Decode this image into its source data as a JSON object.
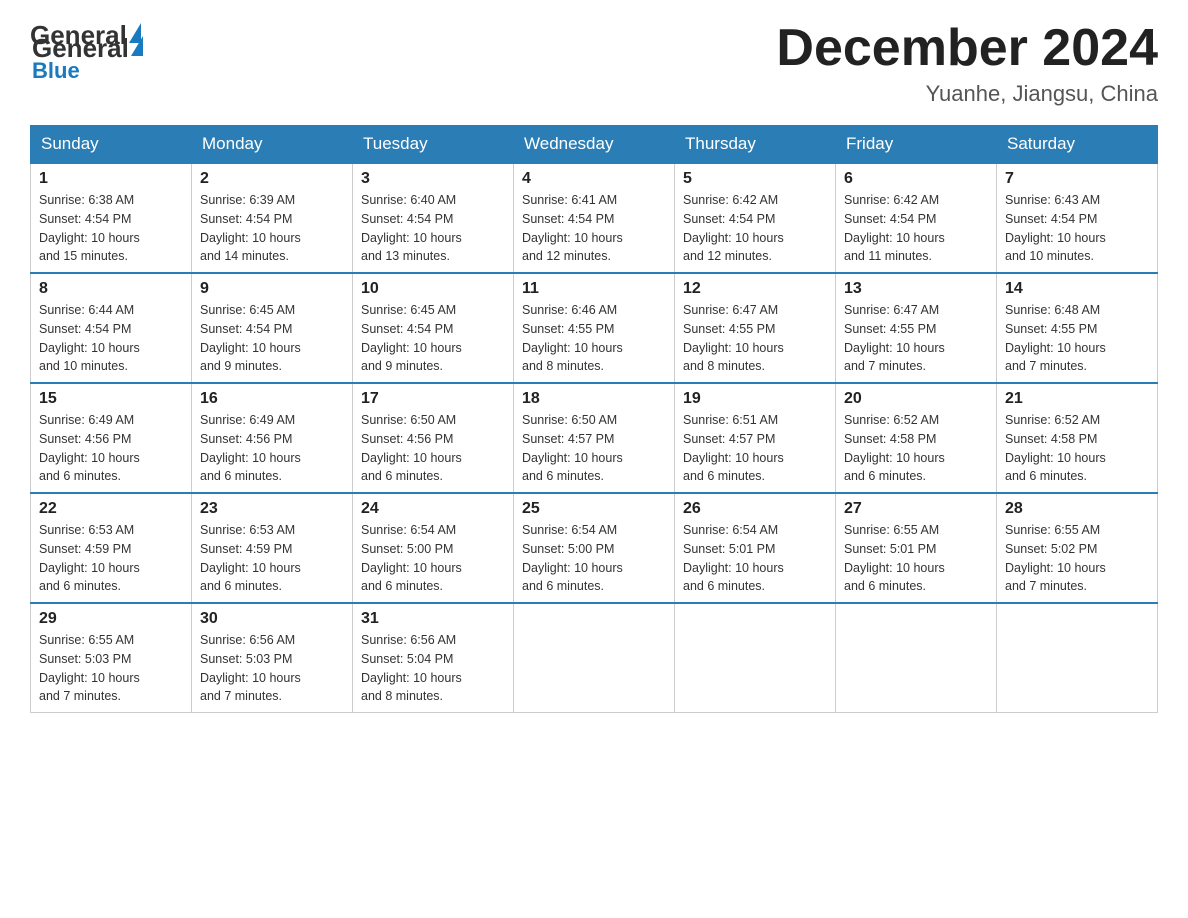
{
  "logo": {
    "general": "General",
    "blue": "Blue"
  },
  "title": "December 2024",
  "subtitle": "Yuanhe, Jiangsu, China",
  "days_of_week": [
    "Sunday",
    "Monday",
    "Tuesday",
    "Wednesday",
    "Thursday",
    "Friday",
    "Saturday"
  ],
  "weeks": [
    [
      {
        "day": "1",
        "sunrise": "6:38 AM",
        "sunset": "4:54 PM",
        "daylight": "10 hours and 15 minutes."
      },
      {
        "day": "2",
        "sunrise": "6:39 AM",
        "sunset": "4:54 PM",
        "daylight": "10 hours and 14 minutes."
      },
      {
        "day": "3",
        "sunrise": "6:40 AM",
        "sunset": "4:54 PM",
        "daylight": "10 hours and 13 minutes."
      },
      {
        "day": "4",
        "sunrise": "6:41 AM",
        "sunset": "4:54 PM",
        "daylight": "10 hours and 12 minutes."
      },
      {
        "day": "5",
        "sunrise": "6:42 AM",
        "sunset": "4:54 PM",
        "daylight": "10 hours and 12 minutes."
      },
      {
        "day": "6",
        "sunrise": "6:42 AM",
        "sunset": "4:54 PM",
        "daylight": "10 hours and 11 minutes."
      },
      {
        "day": "7",
        "sunrise": "6:43 AM",
        "sunset": "4:54 PM",
        "daylight": "10 hours and 10 minutes."
      }
    ],
    [
      {
        "day": "8",
        "sunrise": "6:44 AM",
        "sunset": "4:54 PM",
        "daylight": "10 hours and 10 minutes."
      },
      {
        "day": "9",
        "sunrise": "6:45 AM",
        "sunset": "4:54 PM",
        "daylight": "10 hours and 9 minutes."
      },
      {
        "day": "10",
        "sunrise": "6:45 AM",
        "sunset": "4:54 PM",
        "daylight": "10 hours and 9 minutes."
      },
      {
        "day": "11",
        "sunrise": "6:46 AM",
        "sunset": "4:55 PM",
        "daylight": "10 hours and 8 minutes."
      },
      {
        "day": "12",
        "sunrise": "6:47 AM",
        "sunset": "4:55 PM",
        "daylight": "10 hours and 8 minutes."
      },
      {
        "day": "13",
        "sunrise": "6:47 AM",
        "sunset": "4:55 PM",
        "daylight": "10 hours and 7 minutes."
      },
      {
        "day": "14",
        "sunrise": "6:48 AM",
        "sunset": "4:55 PM",
        "daylight": "10 hours and 7 minutes."
      }
    ],
    [
      {
        "day": "15",
        "sunrise": "6:49 AM",
        "sunset": "4:56 PM",
        "daylight": "10 hours and 6 minutes."
      },
      {
        "day": "16",
        "sunrise": "6:49 AM",
        "sunset": "4:56 PM",
        "daylight": "10 hours and 6 minutes."
      },
      {
        "day": "17",
        "sunrise": "6:50 AM",
        "sunset": "4:56 PM",
        "daylight": "10 hours and 6 minutes."
      },
      {
        "day": "18",
        "sunrise": "6:50 AM",
        "sunset": "4:57 PM",
        "daylight": "10 hours and 6 minutes."
      },
      {
        "day": "19",
        "sunrise": "6:51 AM",
        "sunset": "4:57 PM",
        "daylight": "10 hours and 6 minutes."
      },
      {
        "day": "20",
        "sunrise": "6:52 AM",
        "sunset": "4:58 PM",
        "daylight": "10 hours and 6 minutes."
      },
      {
        "day": "21",
        "sunrise": "6:52 AM",
        "sunset": "4:58 PM",
        "daylight": "10 hours and 6 minutes."
      }
    ],
    [
      {
        "day": "22",
        "sunrise": "6:53 AM",
        "sunset": "4:59 PM",
        "daylight": "10 hours and 6 minutes."
      },
      {
        "day": "23",
        "sunrise": "6:53 AM",
        "sunset": "4:59 PM",
        "daylight": "10 hours and 6 minutes."
      },
      {
        "day": "24",
        "sunrise": "6:54 AM",
        "sunset": "5:00 PM",
        "daylight": "10 hours and 6 minutes."
      },
      {
        "day": "25",
        "sunrise": "6:54 AM",
        "sunset": "5:00 PM",
        "daylight": "10 hours and 6 minutes."
      },
      {
        "day": "26",
        "sunrise": "6:54 AM",
        "sunset": "5:01 PM",
        "daylight": "10 hours and 6 minutes."
      },
      {
        "day": "27",
        "sunrise": "6:55 AM",
        "sunset": "5:01 PM",
        "daylight": "10 hours and 6 minutes."
      },
      {
        "day": "28",
        "sunrise": "6:55 AM",
        "sunset": "5:02 PM",
        "daylight": "10 hours and 7 minutes."
      }
    ],
    [
      {
        "day": "29",
        "sunrise": "6:55 AM",
        "sunset": "5:03 PM",
        "daylight": "10 hours and 7 minutes."
      },
      {
        "day": "30",
        "sunrise": "6:56 AM",
        "sunset": "5:03 PM",
        "daylight": "10 hours and 7 minutes."
      },
      {
        "day": "31",
        "sunrise": "6:56 AM",
        "sunset": "5:04 PM",
        "daylight": "10 hours and 8 minutes."
      },
      null,
      null,
      null,
      null
    ]
  ],
  "labels": {
    "sunrise": "Sunrise:",
    "sunset": "Sunset:",
    "daylight": "Daylight:"
  }
}
